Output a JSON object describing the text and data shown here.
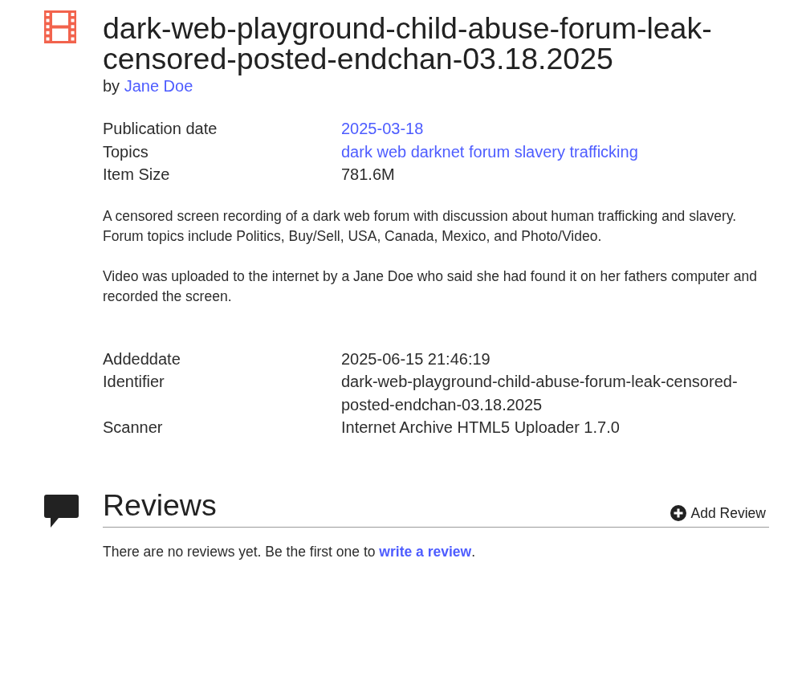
{
  "title": "dark-web-playground-child-abuse-forum-leak-censored-posted-endchan-03.18.2025",
  "byline": {
    "prefix": "by",
    "author": "Jane Doe"
  },
  "metadata": [
    {
      "label": "Publication date",
      "value": "2025-03-18",
      "kind": "link"
    },
    {
      "label": "Topics",
      "value": "dark web darknet forum slavery trafficking",
      "kind": "link"
    },
    {
      "label": "Item Size",
      "value": "781.6M",
      "kind": "text"
    }
  ],
  "description": [
    "A censored screen recording of a dark web forum with discussion about human trafficking and slavery. Forum topics include Politics, Buy/Sell, USA, Canada, Mexico, and Photo/Video.",
    "Video was uploaded to the internet by a Jane Doe who said she had found it on her fathers computer and recorded the screen."
  ],
  "details": [
    {
      "label": "Addeddate",
      "value": "2025-06-15 21:46:19",
      "kind": "text"
    },
    {
      "label": "Identifier",
      "value": "dark-web-playground-child-abuse-forum-leak-censored-posted-endchan-03.18.2025",
      "kind": "text"
    },
    {
      "label": "Scanner",
      "value": "Internet Archive HTML5 Uploader 1.7.0",
      "kind": "text"
    }
  ],
  "reviews": {
    "heading": "Reviews",
    "add_button": "Add Review",
    "empty_text": "There are no reviews yet. Be the first one to",
    "empty_link": "write a review",
    "empty_end": "."
  }
}
